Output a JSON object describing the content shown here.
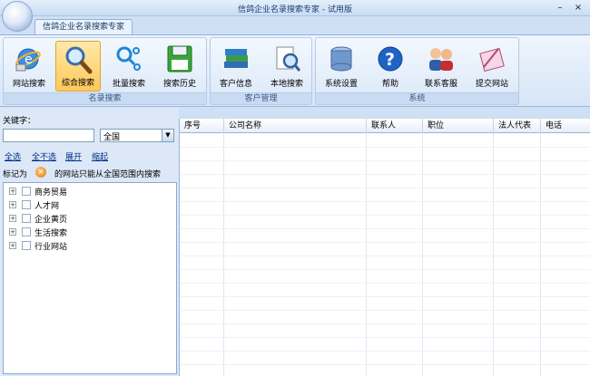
{
  "window": {
    "title": "信鸽企业名录搜索专家 - 试用版",
    "controls": [
      "–",
      "×"
    ]
  },
  "ribbon": {
    "tab": "信鸽企业名录搜索专家",
    "groups": [
      {
        "label": "名录搜索",
        "buttons": [
          "网站搜索",
          "综合搜索",
          "批量搜索",
          "搜索历史"
        ],
        "active": "综合搜索"
      },
      {
        "label": "客户管理",
        "buttons": [
          "客户信息",
          "本地搜索"
        ]
      },
      {
        "label": "系统",
        "buttons": [
          "系统设置",
          "帮助",
          "联系客服",
          "提交网站"
        ]
      }
    ]
  },
  "left": {
    "keyword_label": "关键字：",
    "keyword_value": "",
    "region_select": "全国",
    "links": [
      "全选",
      "全不选",
      "展开",
      "缩起"
    ],
    "note_prefix": "标记为",
    "note_text": "的网站只能从全国范围内搜索",
    "tree": [
      "商务贸易",
      "人才网",
      "企业黄页",
      "生活搜索",
      "行业网站"
    ]
  },
  "grid": {
    "columns": [
      "序号",
      "公司名称",
      "联系人",
      "职位",
      "法人代表",
      "电话"
    ]
  },
  "colors": {
    "ribbon_bg": "#d6e5f7",
    "active_button": "#ffc85a",
    "link": "#00308a"
  }
}
